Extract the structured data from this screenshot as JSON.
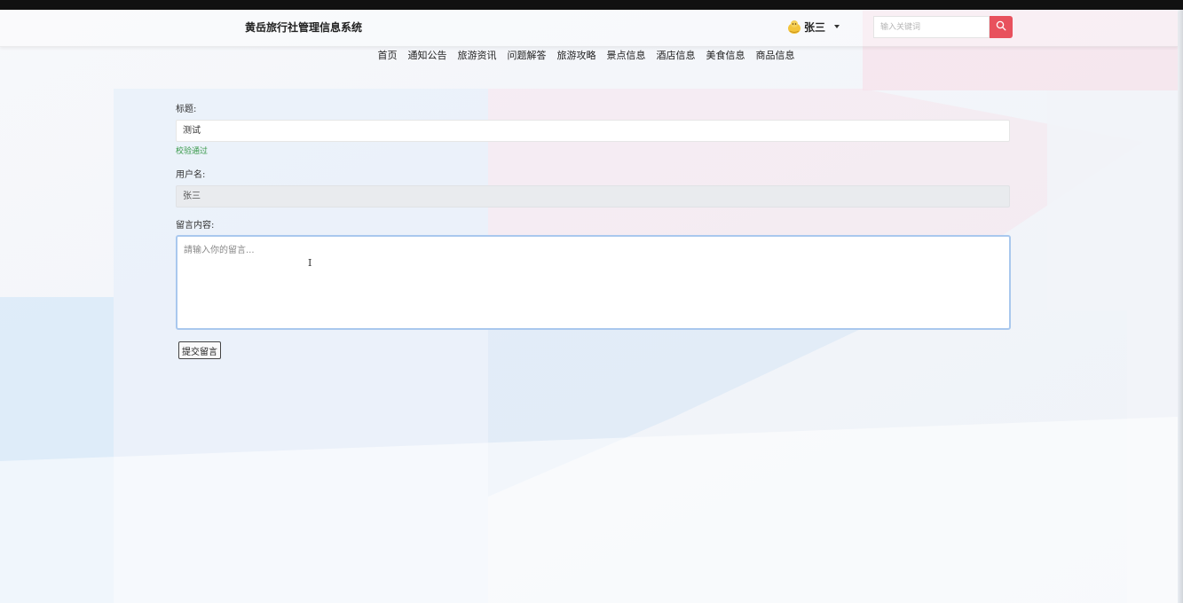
{
  "header": {
    "site_title": "黄岳旅行社管理信息系统",
    "user_name": "张三",
    "search_placeholder": "输入关键词"
  },
  "nav": {
    "items": [
      "首页",
      "通知公告",
      "旅游资讯",
      "问题解答",
      "旅游攻略",
      "景点信息",
      "酒店信息",
      "美食信息",
      "商品信息"
    ]
  },
  "form": {
    "title_label": "标题:",
    "title_value": "测试",
    "title_validation": "校验通过",
    "username_label": "用户名:",
    "username_value": "张三",
    "content_label": "留言内容:",
    "content_placeholder": "請输入你的留言...",
    "submit_label": "提交留言"
  },
  "colors": {
    "search_button": "#e8515d",
    "validation_text": "#3a9a4b",
    "textarea_focus_border": "#a9c8ee"
  }
}
